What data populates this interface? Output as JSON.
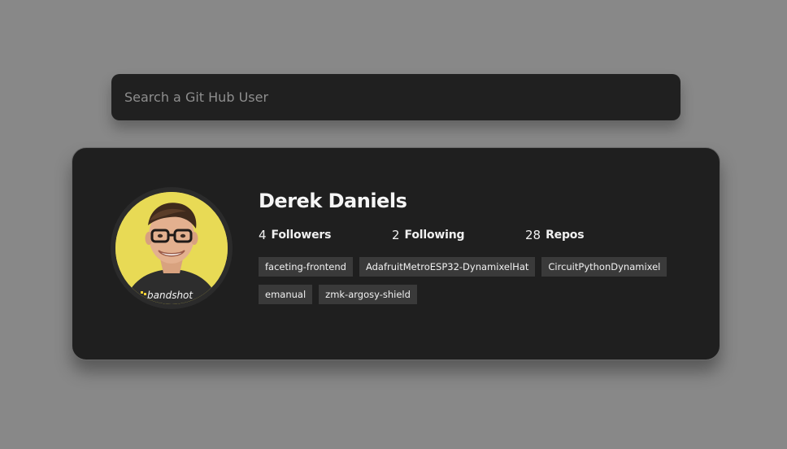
{
  "search": {
    "placeholder": "Search a Git Hub User",
    "value": ""
  },
  "profile": {
    "name": "Derek Daniels",
    "avatar_icon": "user-avatar-photo",
    "shirt_text": "bandshot",
    "stats": [
      {
        "count": "4",
        "label": "Followers"
      },
      {
        "count": "2",
        "label": "Following"
      },
      {
        "count": "28",
        "label": "Repos"
      }
    ],
    "repos": [
      "faceting-frontend",
      "AdafruitMetroESP32-DynamixelHat",
      "CircuitPythonDynamixel",
      "emanual",
      "zmk-argosy-shield"
    ]
  },
  "colors": {
    "page_background": "#888888",
    "card_background": "#1f1f1f",
    "tag_background": "#3a3a3a",
    "avatar_background": "#e8da55"
  }
}
